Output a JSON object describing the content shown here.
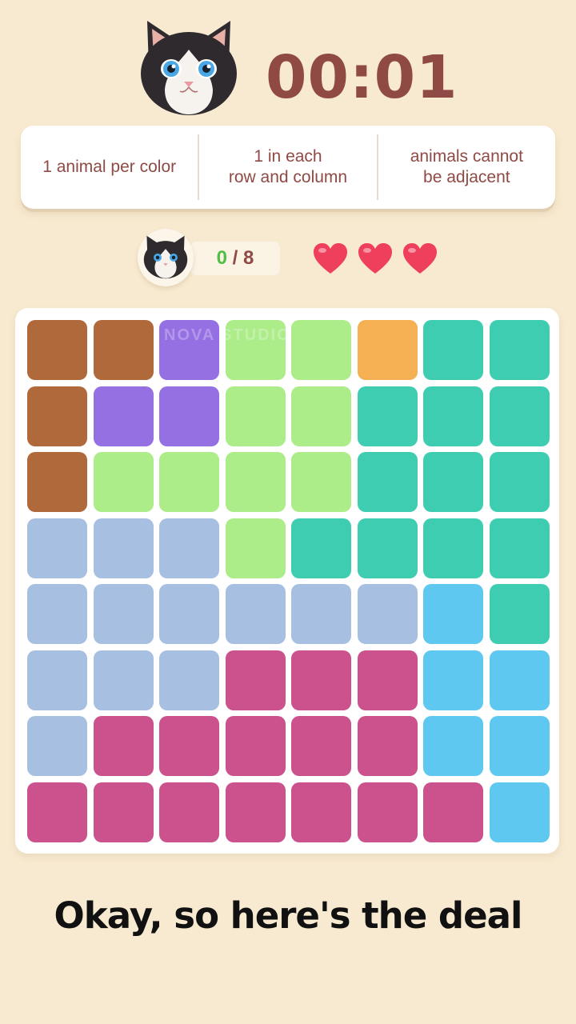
{
  "header": {
    "timer": "00:01"
  },
  "rules": [
    "1 animal per color",
    "1 in each\nrow and column",
    "animals cannot\nbe adjacent"
  ],
  "progress": {
    "current": "0",
    "separator": " / ",
    "total": "8"
  },
  "lives": {
    "remaining": 3
  },
  "watermark": "NOVA STUDIO",
  "board": {
    "size": 8,
    "colors": {
      "B": "#b0693a",
      "P": "#9570e2",
      "L": "#acec89",
      "O": "#f4b053",
      "T": "#3fcdb2",
      "S": "#a7bfe0",
      "C": "#5fc8f0",
      "M": "#cb528c"
    },
    "rows": [
      "BBPLLOTT",
      "BPPLLTTT",
      "BLLLLTTT",
      "SSSLTTTT",
      "SSSSSSCT",
      "SSSMMMCC",
      "SMMMMMCC",
      "MMMMMMMC"
    ]
  },
  "caption": "Okay, so here's the deal"
}
